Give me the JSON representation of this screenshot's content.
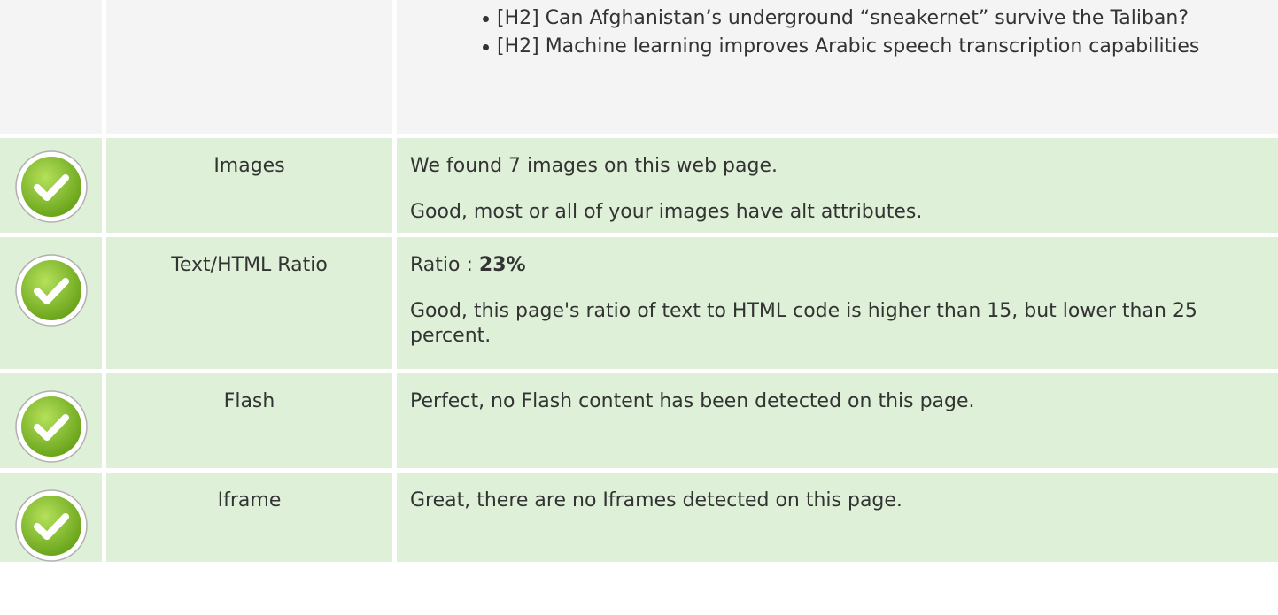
{
  "headings": {
    "items": [
      "[H2] Can Afghanistan’s underground “sneakernet” survive the Taliban?",
      "[H2] Machine learning improves Arabic speech transcription capabilities"
    ]
  },
  "checks": {
    "images": {
      "label": "Images",
      "line1": "We found 7 images on this web page.",
      "line2": "Good, most or all of your images have alt attributes."
    },
    "ratio": {
      "label": "Text/HTML Ratio",
      "prefix": "Ratio : ",
      "value": "23%",
      "line2": "Good, this page's ratio of text to HTML code is higher than 15, but lower than 25 percent."
    },
    "flash": {
      "label": "Flash",
      "line1": "Perfect, no Flash content has been detected on this page."
    },
    "iframe": {
      "label": "Iframe",
      "line1": "Great, there are no Iframes detected on this page."
    }
  },
  "colors": {
    "pass_background": "#dff0d8",
    "neutral_background": "#f4f4f4",
    "check_green": "#8cc63f"
  },
  "icons": {
    "status": "checkmark-circle-icon"
  }
}
